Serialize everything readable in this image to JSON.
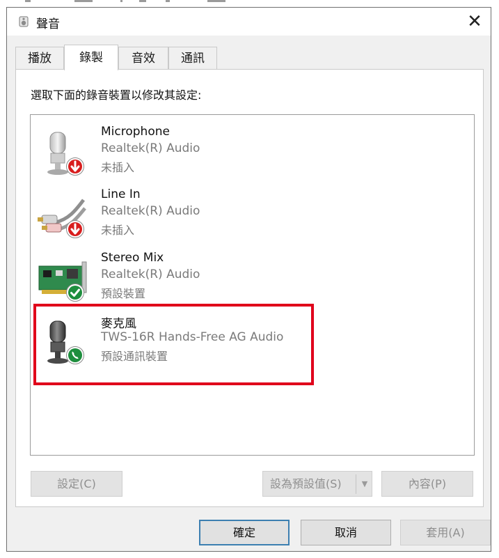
{
  "window": {
    "title": "聲音",
    "close_glyph": "✕",
    "icon": "speaker-icon"
  },
  "tabs": [
    {
      "label": "播放",
      "active": false
    },
    {
      "label": "錄製",
      "active": true
    },
    {
      "label": "音效",
      "active": false
    },
    {
      "label": "通訊",
      "active": false
    }
  ],
  "instruction": "選取下面的錄音裝置以修改其設定:",
  "devices": [
    {
      "name": "Microphone",
      "driver": "Realtek(R) Audio",
      "status": "未插入",
      "icon": "microphone-icon",
      "badge": "unplugged-arrow-icon"
    },
    {
      "name": "Line In",
      "driver": "Realtek(R) Audio",
      "status": "未插入",
      "icon": "rca-cable-icon",
      "badge": "unplugged-arrow-icon"
    },
    {
      "name": "Stereo Mix",
      "driver": "Realtek(R) Audio",
      "status": "預設裝置",
      "icon": "sound-card-icon",
      "badge": "default-check-icon"
    },
    {
      "name": "麥克風",
      "driver": "TWS-16R Hands-Free AG Audio",
      "status": "預設通訊裝置",
      "icon": "microphone-icon",
      "badge": "communication-phone-icon"
    }
  ],
  "buttons": {
    "configure": "設定(C)",
    "set_default": "設為預設值(S)",
    "properties": "內容(P)",
    "ok": "確定",
    "cancel": "取消",
    "apply": "套用(A)"
  },
  "colors": {
    "highlight": "#e0001b",
    "badge_red": "#d81e1e",
    "badge_green": "#1e8e3e"
  }
}
